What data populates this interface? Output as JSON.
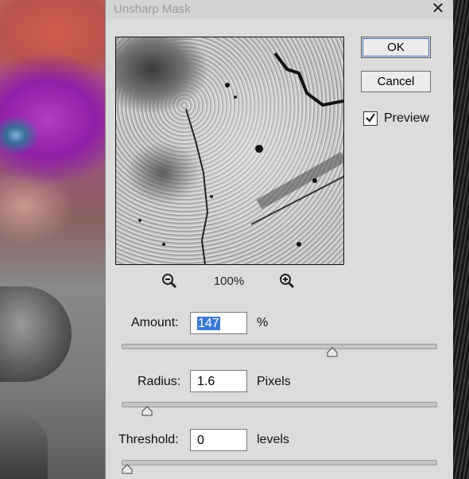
{
  "dialog": {
    "title": "Unsharp Mask",
    "close_glyph": "✕"
  },
  "buttons": {
    "ok_label": "OK",
    "cancel_label": "Cancel"
  },
  "preview": {
    "checkbox_label": "Preview",
    "checked": true,
    "zoom_level": "100%"
  },
  "amount": {
    "label": "Amount:",
    "value": "147",
    "unit": "%",
    "slider_fraction": 0.67
  },
  "radius": {
    "label": "Radius:",
    "value": "1.6",
    "unit": "Pixels",
    "slider_fraction": 0.08
  },
  "threshold": {
    "label": "Threshold:",
    "value": "0",
    "unit": "levels",
    "slider_fraction": 0.0
  },
  "icons": {
    "zoom_out": "zoom-out-icon",
    "zoom_in": "zoom-in-icon",
    "close": "close-icon",
    "check": "checkmark-icon"
  },
  "colors": {
    "dialog_bg": "#dcdcdc",
    "selection": "#3a78d4"
  }
}
